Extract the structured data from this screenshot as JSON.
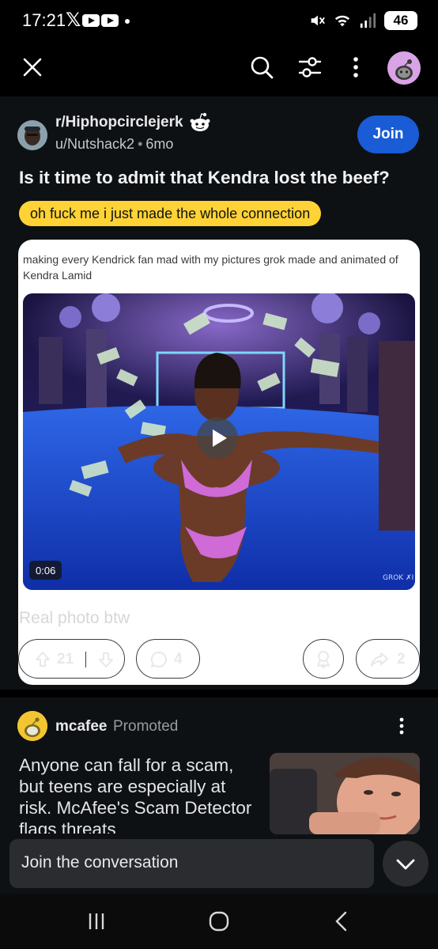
{
  "status_bar": {
    "time": "17:21",
    "x_icon_glyph": "𝕏",
    "battery": "46",
    "signal_icon": "signal-bars-icon",
    "wifi_icon": "wifi-icon",
    "mute_icon": "mute-vibrate-icon"
  },
  "app_bar": {
    "icons": [
      "close-icon",
      "search-icon",
      "filter-icon",
      "more-vertical-icon",
      "avatar"
    ]
  },
  "post": {
    "subreddit": "r/Hiphopcirclejerk",
    "author": "u/Nutshack2",
    "separator": "•",
    "age": "6mo",
    "join_label": "Join",
    "title": "Is it time to admit that Kendra lost the beef?",
    "flair": "oh fuck me i just made the whole connection",
    "embed_caption": "making every Kendrick fan mad with my pictures grok made and animated of Kendra Lamid",
    "video_duration": "0:06",
    "watermark": "GROK ✗I",
    "body": "Real photo btw",
    "upvotes": "21",
    "comments": "4",
    "shares": "2"
  },
  "promoted": {
    "advertiser": "mcafee",
    "tag": "Promoted",
    "text": "Anyone can fall for a scam, but teens are especially at risk. McAfee's Scam Detector flags threats"
  },
  "join_bar": {
    "placeholder": "Join the conversation"
  },
  "colors": {
    "background": "#000000",
    "card": "#0e1113",
    "join_button": "#1a5bd6",
    "flair": "#ffd336",
    "pill_border": "#3a3d41",
    "input": "#2a2c2f"
  }
}
